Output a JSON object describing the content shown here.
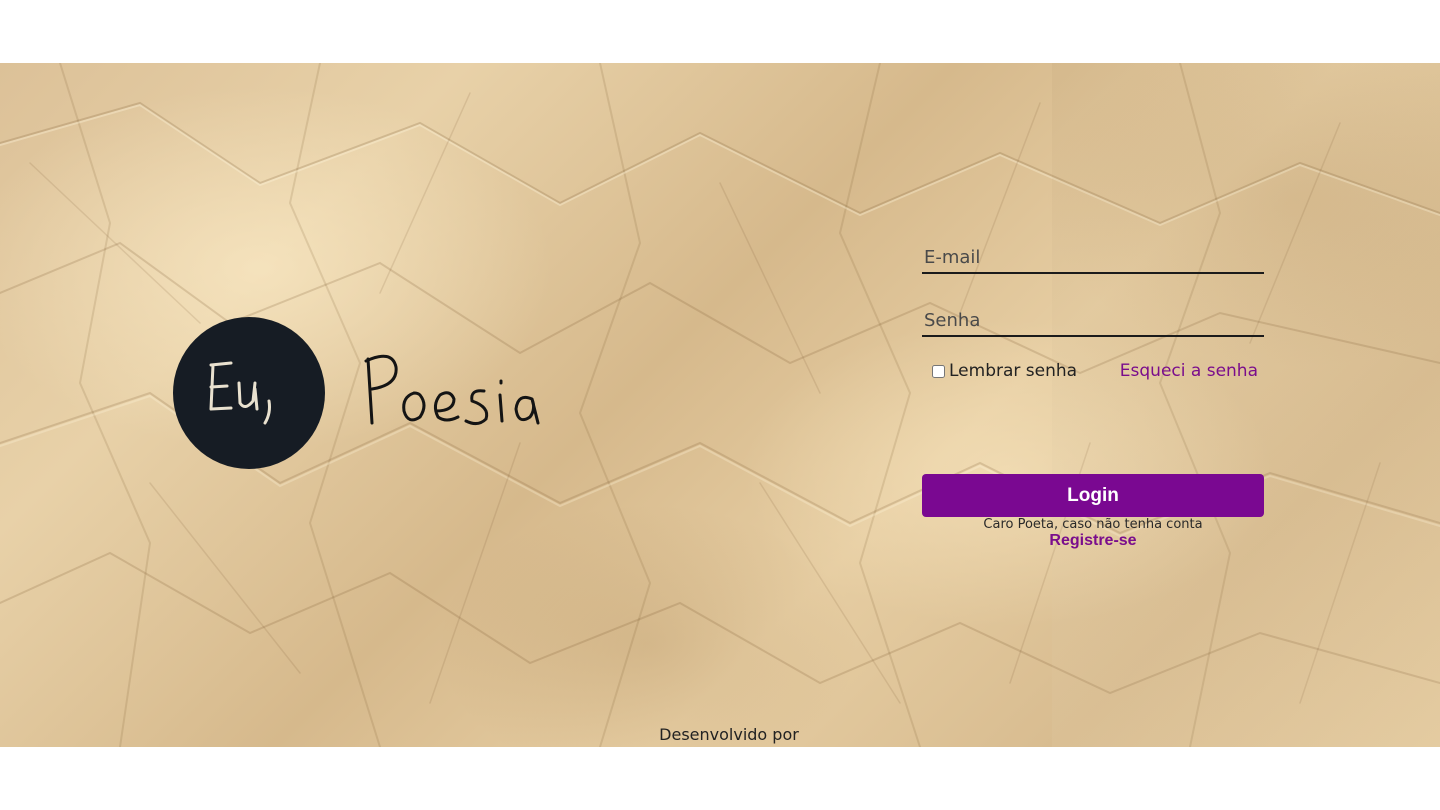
{
  "login_form": {
    "email_placeholder": "E-mail",
    "password_placeholder": "Senha",
    "remember_label": "Lembrar senha",
    "forgot_label": "Esqueci a senha",
    "login_label": "Login",
    "register_note": "Caro Poeta, caso não tenha conta",
    "register_label": "Registre-se"
  },
  "footer": {
    "text": "Desenvolvido por"
  },
  "brand": {
    "logo_text": "Eu,",
    "wordmark": "Poesia"
  },
  "colors": {
    "accent": "#7a0891",
    "link": "#7a0d8c",
    "logo_circle": "#161c24",
    "paper": "#dcc198"
  }
}
